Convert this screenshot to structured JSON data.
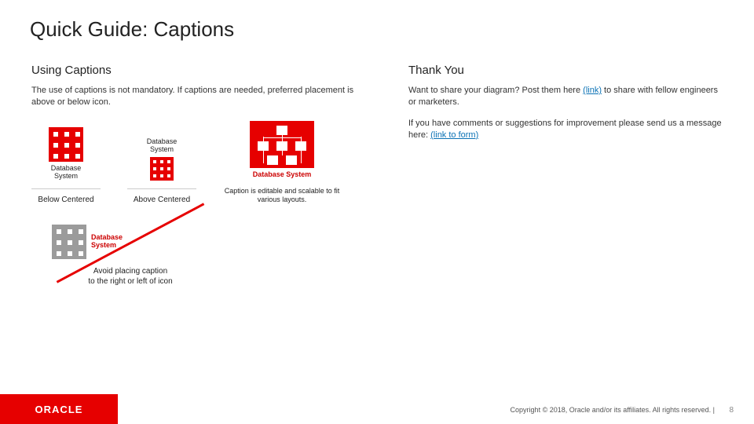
{
  "title": "Quick Guide: Captions",
  "left": {
    "heading": "Using Captions",
    "body": "The use of captions is not mandatory. If captions are needed, preferred placement is above or below icon.",
    "ex_below": {
      "caption": "Database\nSystem",
      "label": "Below Centered"
    },
    "ex_above": {
      "caption": "Database\nSystem",
      "label": "Above Centered"
    },
    "ex_wide": {
      "caption": "Database System",
      "note": "Caption is editable and scalable to fit various layouts."
    },
    "ex_avoid": {
      "caption": "Database\nSystem",
      "note": "Avoid placing caption\nto the right or left of icon"
    }
  },
  "right": {
    "heading": "Thank You",
    "p1_pre": "Want to share your diagram? Post them here ",
    "p1_link": "(link)",
    "p1_post": " to share with fellow engineers or marketers.",
    "p2_pre": "If you have comments or suggestions for improvement please send us a message here: ",
    "p2_link": "(link to form)"
  },
  "footer": {
    "logo": "ORACLE",
    "copyright": "Copyright © 2018, Oracle and/or its affiliates. All rights reserved.   |",
    "page": "8"
  }
}
